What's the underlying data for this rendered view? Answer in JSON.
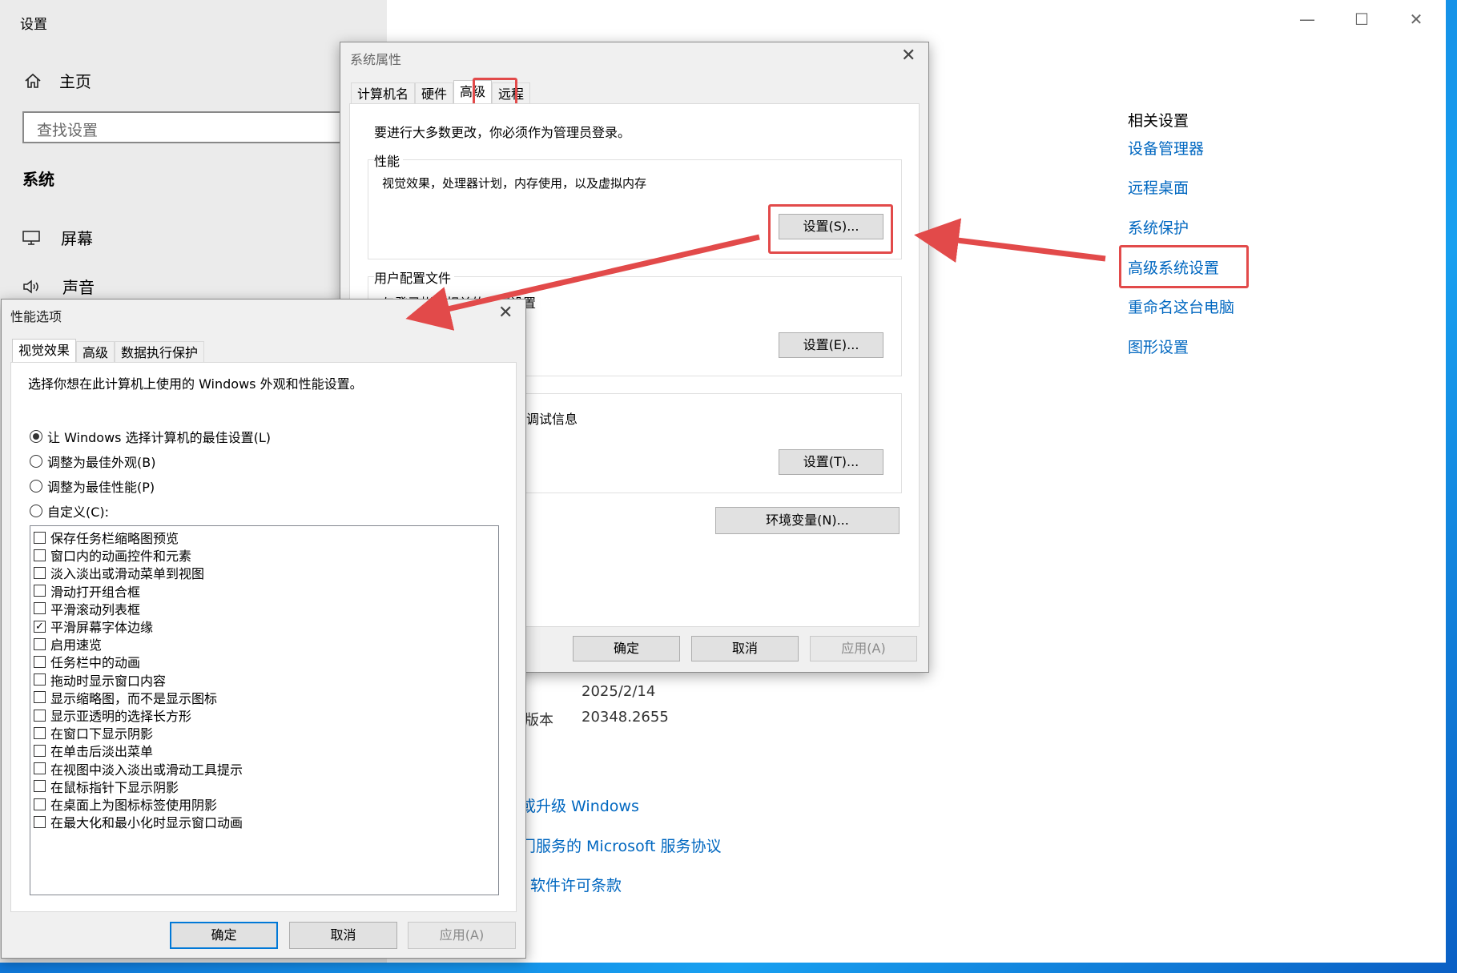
{
  "settings": {
    "title": "设置",
    "home": "主页",
    "search_placeholder": "查找设置",
    "section": "系统",
    "nav": [
      "屏幕",
      "声音"
    ],
    "related": {
      "title": "相关设置",
      "links": [
        "设备管理器",
        "远程桌面",
        "系统保护",
        "高级系统设置",
        "重命名这台电脑",
        "图形设置"
      ]
    },
    "info": {
      "date": "2025/2/14",
      "build_label": "版本",
      "build": "20348.2655"
    },
    "bottom_links": [
      "或升级 Windows",
      "门服务的 Microsoft 服务协议",
      "软件许可条款"
    ]
  },
  "sysprops": {
    "title": "系统属性",
    "tabs": [
      "计算机名",
      "硬件",
      "高级",
      "远程"
    ],
    "admin_note": "要进行大多数更改，你必须作为管理员登录。",
    "perf_label": "性能",
    "perf_desc": "视觉效果，处理器计划，内存使用，以及虚拟内存",
    "perf_btn": "设置(S)...",
    "profile_label": "用户配置文件",
    "profile_desc": "与登录帐户相关的桌面设置",
    "profile_btn": "设置(E)...",
    "startup_desc": "调试信息",
    "startup_btn": "设置(T)...",
    "env_btn": "环境变量(N)...",
    "ok": "确定",
    "cancel": "取消",
    "apply": "应用(A)"
  },
  "perf": {
    "title": "性能选项",
    "tabs": [
      "视觉效果",
      "高级",
      "数据执行保护"
    ],
    "desc": "选择你想在此计算机上使用的 Windows 外观和性能设置。",
    "radios": [
      "让 Windows 选择计算机的最佳设置(L)",
      "调整为最佳外观(B)",
      "调整为最佳性能(P)",
      "自定义(C):"
    ],
    "checks": [
      {
        "label": "保存任务栏缩略图预览",
        "checked": false
      },
      {
        "label": "窗口内的动画控件和元素",
        "checked": false
      },
      {
        "label": "淡入淡出或滑动菜单到视图",
        "checked": false
      },
      {
        "label": "滑动打开组合框",
        "checked": false
      },
      {
        "label": "平滑滚动列表框",
        "checked": false
      },
      {
        "label": "平滑屏幕字体边缘",
        "checked": true
      },
      {
        "label": "启用速览",
        "checked": false
      },
      {
        "label": "任务栏中的动画",
        "checked": false
      },
      {
        "label": "拖动时显示窗口内容",
        "checked": false
      },
      {
        "label": "显示缩略图，而不是显示图标",
        "checked": false
      },
      {
        "label": "显示亚透明的选择长方形",
        "checked": false
      },
      {
        "label": "在窗口下显示阴影",
        "checked": false
      },
      {
        "label": "在单击后淡出菜单",
        "checked": false
      },
      {
        "label": "在视图中淡入淡出或滑动工具提示",
        "checked": false
      },
      {
        "label": "在鼠标指针下显示阴影",
        "checked": false
      },
      {
        "label": "在桌面上为图标标签使用阴影",
        "checked": false
      },
      {
        "label": "在最大化和最小化时显示窗口动画",
        "checked": false
      }
    ],
    "ok": "确定",
    "cancel": "取消",
    "apply": "应用(A)"
  }
}
